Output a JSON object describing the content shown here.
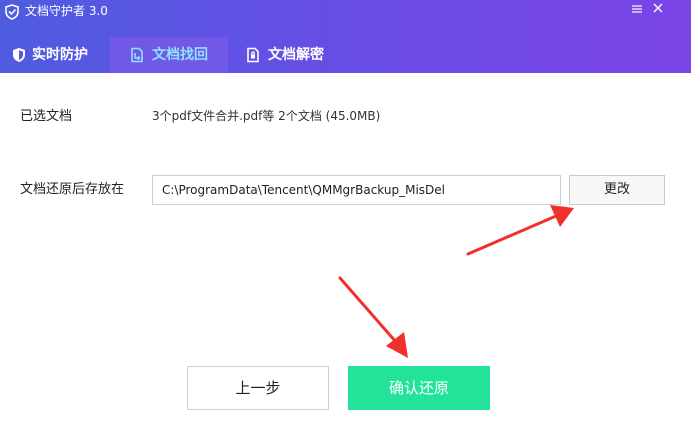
{
  "window": {
    "title": "文档守护者 3.0",
    "logo_icon": "shield-logo-icon",
    "menu_icon": "menu-icon",
    "close_icon": "close-icon"
  },
  "tabs": [
    {
      "label": "实时防护",
      "icon": "shield-icon"
    },
    {
      "label": "文档找回",
      "icon": "document-restore-icon",
      "active": true
    },
    {
      "label": "文档解密",
      "icon": "document-decrypt-icon"
    }
  ],
  "form": {
    "selected_label": "已选文档",
    "selected_value": "3个pdf文件合并.pdf等 2个文档 (45.0MB)",
    "save_label": "文档还原后存放在",
    "save_path": "C:\\ProgramData\\Tencent\\QMMgrBackup_MisDel",
    "change_button": "更改"
  },
  "footer": {
    "prev_button": "上一步",
    "confirm_button": "确认还原"
  },
  "colors": {
    "header_start": "#4f5ce0",
    "header_end": "#7b44e6",
    "active_tab_text": "#8de3ff",
    "confirm_bg": "#23e39a",
    "arrow": "#f0302b"
  }
}
